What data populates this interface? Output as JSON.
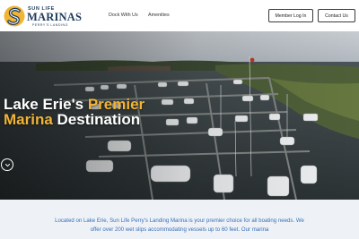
{
  "brand": {
    "top": "SUN LIFE",
    "main": "MARINAS",
    "sub": "PERRY'S LANDING",
    "colors": {
      "navy": "#1f3b5c",
      "gold": "#f1b434"
    }
  },
  "nav": {
    "items": [
      {
        "label": "Dock With Us"
      },
      {
        "label": "Amenities"
      }
    ]
  },
  "header_buttons": {
    "member_login": "Member Log In",
    "contact": "Contact Us"
  },
  "hero": {
    "headline_part1": "Lake Erie's ",
    "headline_accent1": "Premier",
    "headline_accent2": "Marina",
    "headline_part2": " Destination",
    "scroll_icon": "chevron-down-icon"
  },
  "intro": {
    "text": "Located on Lake Erie, Sun Life Perry's Landing Marina is your premier choice for all boating needs. We offer over 200 wet slips accommodating vessels up to 60 feet. Our marina"
  }
}
